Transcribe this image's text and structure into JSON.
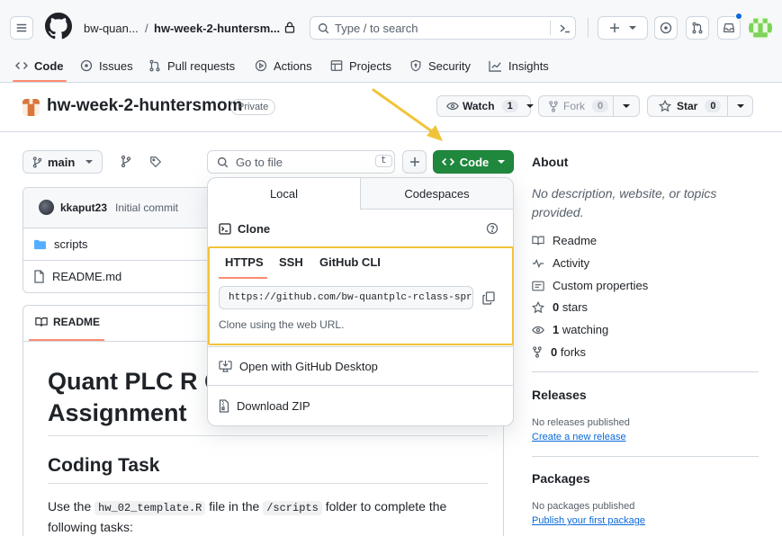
{
  "header": {
    "owner": "bw-quan...",
    "separator": "/",
    "repo_short": "hw-week-2-huntersm...",
    "search_placeholder": "Type / to search"
  },
  "nav": {
    "tabs": [
      {
        "label": "Code"
      },
      {
        "label": "Issues"
      },
      {
        "label": "Pull requests"
      },
      {
        "label": "Actions"
      },
      {
        "label": "Projects"
      },
      {
        "label": "Security"
      },
      {
        "label": "Insights"
      }
    ]
  },
  "repo": {
    "name": "hw-week-2-huntersmom",
    "visibility": "Private",
    "watch_label": "Watch",
    "watch_count": "1",
    "fork_label": "Fork",
    "fork_count": "0",
    "star_label": "Star",
    "star_count": "0"
  },
  "toolbar": {
    "branch": "main",
    "goto_placeholder": "Go to file",
    "goto_shortcut": "t",
    "code_button": "Code"
  },
  "commit": {
    "author": "kkaput23",
    "message": "Initial commit"
  },
  "files": [
    {
      "name": "scripts",
      "type": "folder"
    },
    {
      "name": "README.md",
      "type": "file"
    }
  ],
  "readme": {
    "tab_label": "README",
    "heading_line1": "Quant PLC R C",
    "heading_line2": "Assignment",
    "h2": "Coding Task",
    "para_before": "Use the",
    "code1": "hw_02_template.R",
    "para_mid": "file in the",
    "code2": "/scripts",
    "para_after": "folder to complete the",
    "para_line2": "following tasks:"
  },
  "dropdown": {
    "tab_local": "Local",
    "tab_codespaces": "Codespaces",
    "clone_label": "Clone",
    "proto_tabs": [
      "HTTPS",
      "SSH",
      "GitHub CLI"
    ],
    "url": "https://github.com/bw-quantplc-rclass-spr:",
    "hint": "Clone using the web URL.",
    "open_desktop": "Open with GitHub Desktop",
    "download_zip": "Download ZIP"
  },
  "about": {
    "title": "About",
    "description": "No description, website, or topics provided.",
    "items": [
      {
        "icon": "book-icon",
        "label": "Readme"
      },
      {
        "icon": "pulse-icon",
        "label": "Activity"
      },
      {
        "icon": "note-icon",
        "label": "Custom properties"
      },
      {
        "icon": "star-icon",
        "count": "0",
        "label": "stars"
      },
      {
        "icon": "eye-icon",
        "count": "1",
        "label": "watching"
      },
      {
        "icon": "fork-icon",
        "count": "0",
        "label": "forks"
      }
    ]
  },
  "releases": {
    "title": "Releases",
    "none_text": "No releases published",
    "create_link": "Create a new release"
  },
  "packages": {
    "title": "Packages",
    "none_text": "No packages published",
    "publish_link": "Publish your first package"
  },
  "colors": {
    "accent_green": "#1f883d",
    "annotation_yellow": "#f0c43a",
    "link_blue": "#0969da",
    "tab_underline": "#fd8c73"
  }
}
